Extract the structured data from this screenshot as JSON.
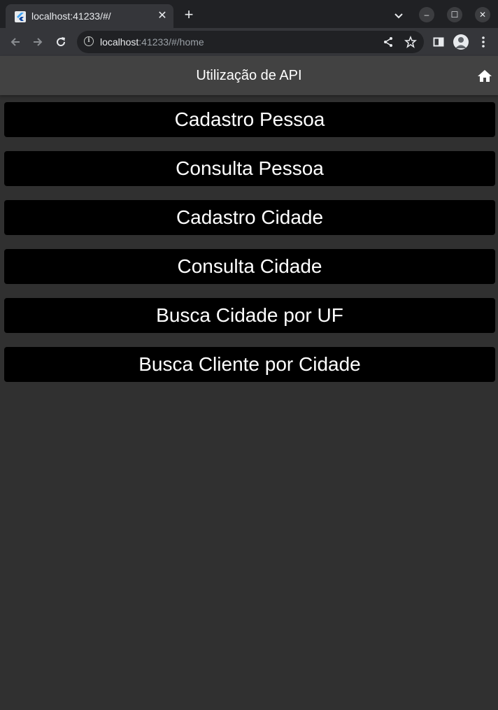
{
  "browser": {
    "tab_title": "localhost:41233/#/",
    "tab_close": "✕",
    "new_tab": "+",
    "minimize": "–",
    "maximize": "☐",
    "close": "✕",
    "url_host": "localhost",
    "url_rest": ":41233/#/home"
  },
  "appbar": {
    "title": "Utilização de API",
    "home_icon": "home-icon"
  },
  "menu": [
    {
      "label": "Cadastro Pessoa"
    },
    {
      "label": "Consulta Pessoa"
    },
    {
      "label": "Cadastro Cidade"
    },
    {
      "label": "Consulta Cidade"
    },
    {
      "label": "Busca Cidade por UF"
    },
    {
      "label": "Busca Cliente por Cidade"
    }
  ],
  "colors": {
    "background": "#303030",
    "appbar": "#424242",
    "button": "#000000",
    "text": "#ffffff"
  }
}
